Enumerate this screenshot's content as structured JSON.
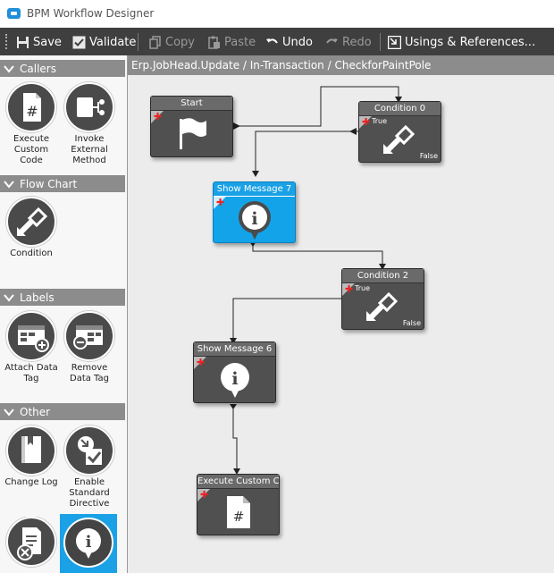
{
  "window": {
    "title": "BPM Workflow Designer"
  },
  "toolbar": {
    "save": "Save",
    "validate": "Validate",
    "copy": "Copy",
    "paste": "Paste",
    "undo": "Undo",
    "redo": "Redo",
    "usings": "Usings & References..."
  },
  "palette": {
    "callers": {
      "title": "Callers",
      "items": [
        "Execute Custom Code",
        "Invoke External Method"
      ]
    },
    "flow_chart": {
      "title": "Flow Chart",
      "items": [
        "Condition"
      ]
    },
    "labels": {
      "title": "Labels",
      "items": [
        "Attach Data Tag",
        "Remove Data Tag"
      ]
    },
    "other": {
      "title": "Other",
      "items": [
        "Change Log",
        "Enable Standard Directive"
      ]
    }
  },
  "canvas": {
    "breadcrumb": "Erp.JobHead.Update / In-Transaction / CheckforPaintPole",
    "nodes": {
      "start": {
        "title": "Start"
      },
      "condition0": {
        "title": "Condition 0",
        "true_label": "True",
        "false_label": "False"
      },
      "show_message7": {
        "title": "Show Message 7"
      },
      "condition2": {
        "title": "Condition 2",
        "true_label": "True",
        "false_label": "False"
      },
      "show_message6": {
        "title": "Show Message 6"
      },
      "execute_custom": {
        "title": "Execute Custom Co"
      }
    }
  },
  "colors": {
    "selected": "#1aa1e6",
    "toolbar": "#3f3f3f",
    "header": "#8c8c8c",
    "node": "#505050"
  }
}
